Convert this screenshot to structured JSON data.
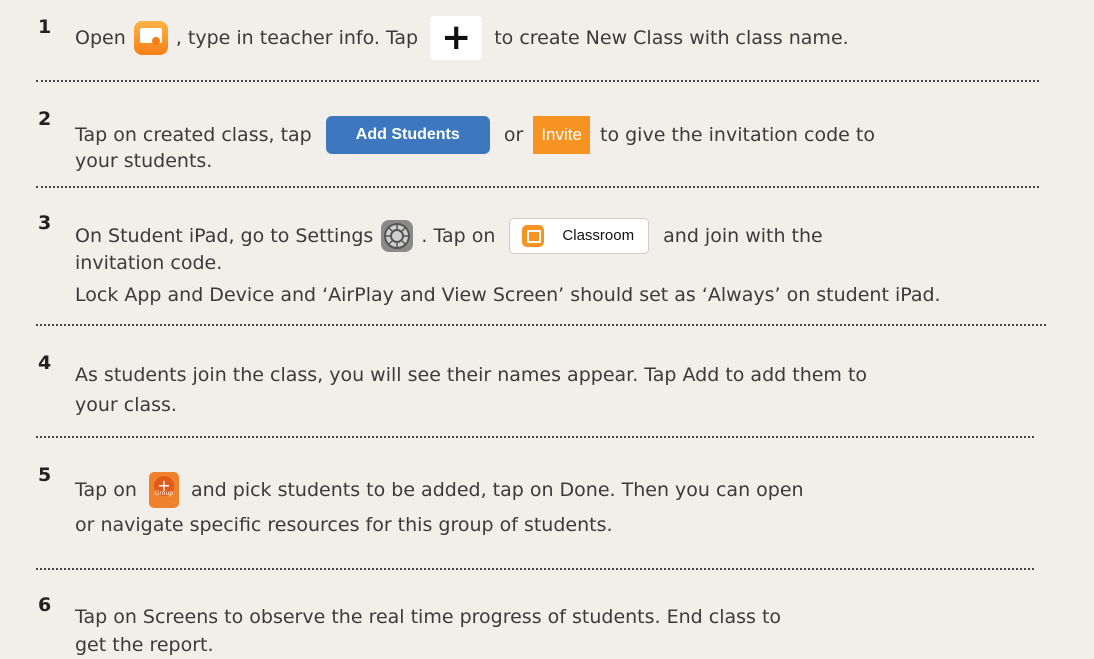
{
  "steps": [
    {
      "num": "1",
      "parts": [
        "Open",
        ", type in teacher info. Tap",
        "to create New Class with class name."
      ]
    },
    {
      "num": "2",
      "parts": [
        "Tap on created class, tap",
        "or",
        "to give the invitation code to"
      ],
      "line2": "your students.",
      "add_students": "Add Students",
      "invite": "Invite"
    },
    {
      "num": "3",
      "parts": [
        "On Student iPad, go to Settings",
        ". Tap on",
        "and join with the"
      ],
      "line2": "invitation code.",
      "line3": "Lock App and Device and ‘AirPlay and View Screen’ should set as ‘Always’ on student iPad.",
      "classroom": "Classroom"
    },
    {
      "num": "4",
      "line1": "As students join the class, you will see their names appear. Tap Add to add them to",
      "line2": "your class."
    },
    {
      "num": "5",
      "parts": [
        "Tap on",
        "and pick students to be added, tap on Done. Then you can open"
      ],
      "line2": "or navigate specific resources for this group of students.",
      "group_label": "Group",
      "plus_glyph": "+"
    },
    {
      "num": "6",
      "line1": "Tap on Screens to observe the real time progress of students. End class to",
      "line2": "get the report."
    }
  ],
  "icons": {
    "classroom_app": "classroom-app-icon",
    "plus": "plus-icon",
    "settings": "settings-gear-icon",
    "group": "group-add-icon"
  },
  "plus_symbol": "+",
  "colors": {
    "background": "#f2eee9",
    "blue": "#3d78bf",
    "orange": "#f79321"
  }
}
